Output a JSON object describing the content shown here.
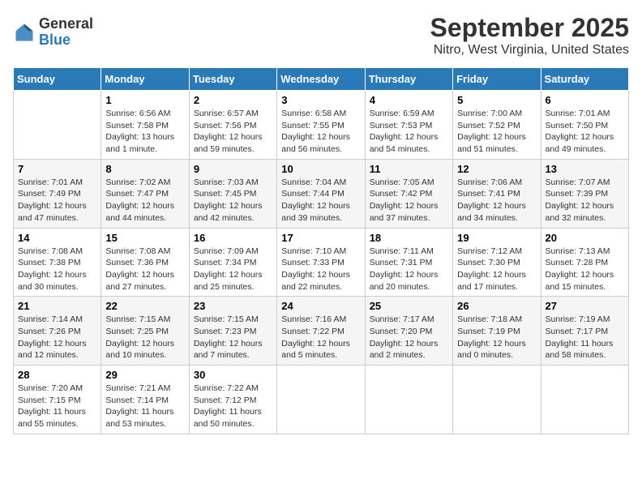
{
  "logo": {
    "general": "General",
    "blue": "Blue"
  },
  "header": {
    "title": "September 2025",
    "subtitle": "Nitro, West Virginia, United States"
  },
  "days_of_week": [
    "Sunday",
    "Monday",
    "Tuesday",
    "Wednesday",
    "Thursday",
    "Friday",
    "Saturday"
  ],
  "weeks": [
    [
      null,
      {
        "date": "1",
        "sunrise": "Sunrise: 6:56 AM",
        "sunset": "Sunset: 7:58 PM",
        "daylight": "Daylight: 13 hours and 1 minute."
      },
      {
        "date": "2",
        "sunrise": "Sunrise: 6:57 AM",
        "sunset": "Sunset: 7:56 PM",
        "daylight": "Daylight: 12 hours and 59 minutes."
      },
      {
        "date": "3",
        "sunrise": "Sunrise: 6:58 AM",
        "sunset": "Sunset: 7:55 PM",
        "daylight": "Daylight: 12 hours and 56 minutes."
      },
      {
        "date": "4",
        "sunrise": "Sunrise: 6:59 AM",
        "sunset": "Sunset: 7:53 PM",
        "daylight": "Daylight: 12 hours and 54 minutes."
      },
      {
        "date": "5",
        "sunrise": "Sunrise: 7:00 AM",
        "sunset": "Sunset: 7:52 PM",
        "daylight": "Daylight: 12 hours and 51 minutes."
      },
      {
        "date": "6",
        "sunrise": "Sunrise: 7:01 AM",
        "sunset": "Sunset: 7:50 PM",
        "daylight": "Daylight: 12 hours and 49 minutes."
      }
    ],
    [
      {
        "date": "7",
        "sunrise": "Sunrise: 7:01 AM",
        "sunset": "Sunset: 7:49 PM",
        "daylight": "Daylight: 12 hours and 47 minutes."
      },
      {
        "date": "8",
        "sunrise": "Sunrise: 7:02 AM",
        "sunset": "Sunset: 7:47 PM",
        "daylight": "Daylight: 12 hours and 44 minutes."
      },
      {
        "date": "9",
        "sunrise": "Sunrise: 7:03 AM",
        "sunset": "Sunset: 7:45 PM",
        "daylight": "Daylight: 12 hours and 42 minutes."
      },
      {
        "date": "10",
        "sunrise": "Sunrise: 7:04 AM",
        "sunset": "Sunset: 7:44 PM",
        "daylight": "Daylight: 12 hours and 39 minutes."
      },
      {
        "date": "11",
        "sunrise": "Sunrise: 7:05 AM",
        "sunset": "Sunset: 7:42 PM",
        "daylight": "Daylight: 12 hours and 37 minutes."
      },
      {
        "date": "12",
        "sunrise": "Sunrise: 7:06 AM",
        "sunset": "Sunset: 7:41 PM",
        "daylight": "Daylight: 12 hours and 34 minutes."
      },
      {
        "date": "13",
        "sunrise": "Sunrise: 7:07 AM",
        "sunset": "Sunset: 7:39 PM",
        "daylight": "Daylight: 12 hours and 32 minutes."
      }
    ],
    [
      {
        "date": "14",
        "sunrise": "Sunrise: 7:08 AM",
        "sunset": "Sunset: 7:38 PM",
        "daylight": "Daylight: 12 hours and 30 minutes."
      },
      {
        "date": "15",
        "sunrise": "Sunrise: 7:08 AM",
        "sunset": "Sunset: 7:36 PM",
        "daylight": "Daylight: 12 hours and 27 minutes."
      },
      {
        "date": "16",
        "sunrise": "Sunrise: 7:09 AM",
        "sunset": "Sunset: 7:34 PM",
        "daylight": "Daylight: 12 hours and 25 minutes."
      },
      {
        "date": "17",
        "sunrise": "Sunrise: 7:10 AM",
        "sunset": "Sunset: 7:33 PM",
        "daylight": "Daylight: 12 hours and 22 minutes."
      },
      {
        "date": "18",
        "sunrise": "Sunrise: 7:11 AM",
        "sunset": "Sunset: 7:31 PM",
        "daylight": "Daylight: 12 hours and 20 minutes."
      },
      {
        "date": "19",
        "sunrise": "Sunrise: 7:12 AM",
        "sunset": "Sunset: 7:30 PM",
        "daylight": "Daylight: 12 hours and 17 minutes."
      },
      {
        "date": "20",
        "sunrise": "Sunrise: 7:13 AM",
        "sunset": "Sunset: 7:28 PM",
        "daylight": "Daylight: 12 hours and 15 minutes."
      }
    ],
    [
      {
        "date": "21",
        "sunrise": "Sunrise: 7:14 AM",
        "sunset": "Sunset: 7:26 PM",
        "daylight": "Daylight: 12 hours and 12 minutes."
      },
      {
        "date": "22",
        "sunrise": "Sunrise: 7:15 AM",
        "sunset": "Sunset: 7:25 PM",
        "daylight": "Daylight: 12 hours and 10 minutes."
      },
      {
        "date": "23",
        "sunrise": "Sunrise: 7:15 AM",
        "sunset": "Sunset: 7:23 PM",
        "daylight": "Daylight: 12 hours and 7 minutes."
      },
      {
        "date": "24",
        "sunrise": "Sunrise: 7:16 AM",
        "sunset": "Sunset: 7:22 PM",
        "daylight": "Daylight: 12 hours and 5 minutes."
      },
      {
        "date": "25",
        "sunrise": "Sunrise: 7:17 AM",
        "sunset": "Sunset: 7:20 PM",
        "daylight": "Daylight: 12 hours and 2 minutes."
      },
      {
        "date": "26",
        "sunrise": "Sunrise: 7:18 AM",
        "sunset": "Sunset: 7:19 PM",
        "daylight": "Daylight: 12 hours and 0 minutes."
      },
      {
        "date": "27",
        "sunrise": "Sunrise: 7:19 AM",
        "sunset": "Sunset: 7:17 PM",
        "daylight": "Daylight: 11 hours and 58 minutes."
      }
    ],
    [
      {
        "date": "28",
        "sunrise": "Sunrise: 7:20 AM",
        "sunset": "Sunset: 7:15 PM",
        "daylight": "Daylight: 11 hours and 55 minutes."
      },
      {
        "date": "29",
        "sunrise": "Sunrise: 7:21 AM",
        "sunset": "Sunset: 7:14 PM",
        "daylight": "Daylight: 11 hours and 53 minutes."
      },
      {
        "date": "30",
        "sunrise": "Sunrise: 7:22 AM",
        "sunset": "Sunset: 7:12 PM",
        "daylight": "Daylight: 11 hours and 50 minutes."
      },
      null,
      null,
      null,
      null
    ]
  ]
}
